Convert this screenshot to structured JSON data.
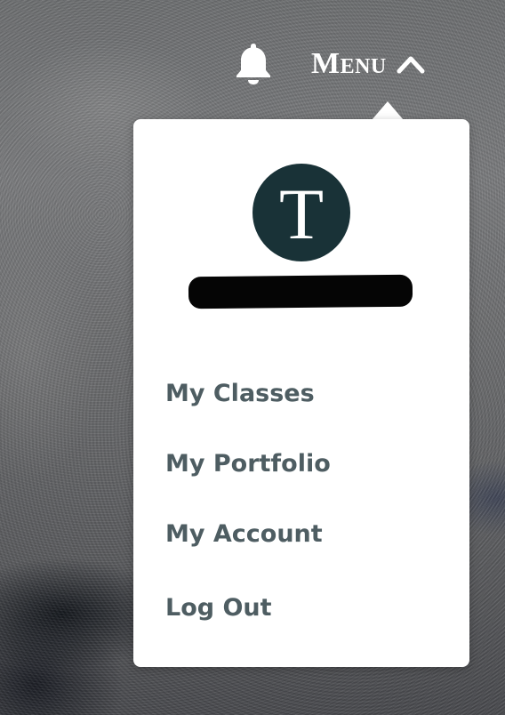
{
  "header": {
    "bell_icon": "bell-icon",
    "menu_label": "Menu",
    "menu_chevron_icon": "chevron-up-icon"
  },
  "dropdown": {
    "avatar_initial": "T",
    "avatar_color": "#193237",
    "user_name_redacted": true,
    "items": [
      {
        "label": "My Classes"
      },
      {
        "label": "My Portfolio"
      },
      {
        "label": "My Account"
      },
      {
        "label": "Log Out"
      }
    ],
    "item_color": "#4e5d62"
  }
}
